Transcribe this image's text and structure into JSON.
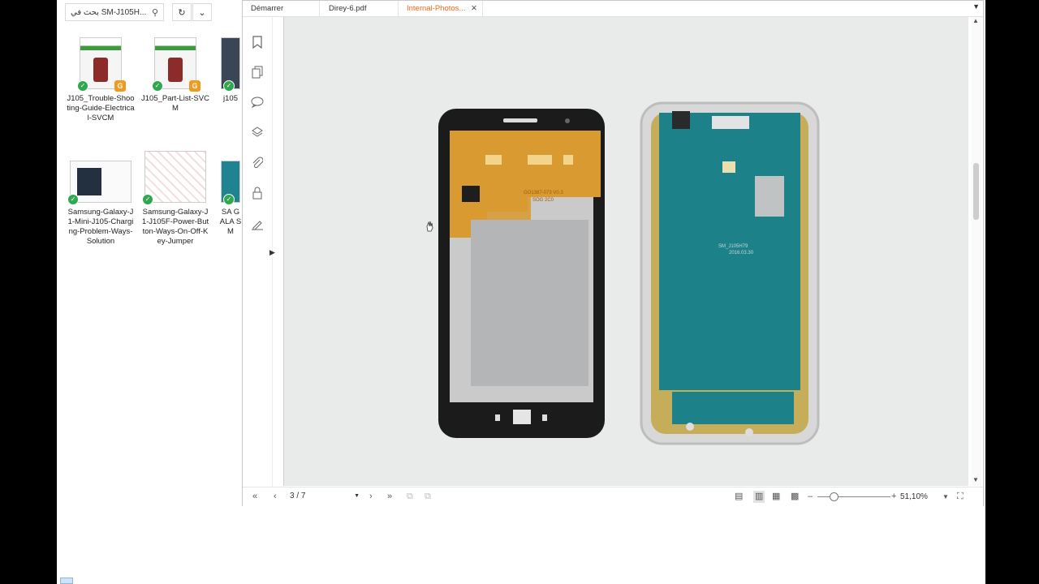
{
  "explorer": {
    "search_text": "بحث في SM-J105H...",
    "files": [
      {
        "name": "J105_Trouble-Shooting-Guide-Electrical-SVCM"
      },
      {
        "name": "J105_Part-List-SVCM"
      },
      {
        "name": "j105"
      },
      {
        "name": "Samsung-Galaxy-J1-Mini-J105-Charging-Problem-Ways-Solution"
      },
      {
        "name": "Samsung-Galaxy-J1-J105F-Power-Button-Ways-On-Off-Key-Jumper"
      },
      {
        "name": "SA GALA SM"
      }
    ]
  },
  "pdf": {
    "tabs": [
      {
        "label": "Démarrer"
      },
      {
        "label": "Direy-6.pdf"
      },
      {
        "label": "Internal-Photos..."
      }
    ],
    "page_indicator": "3 / 7",
    "zoom_label": "51,10%",
    "board_print": {
      "line1": "GO1387-073 V0.3",
      "line2": "SOG 2C0",
      "pcb_label1": "SM_J105H79",
      "pcb_label2": "2016.03.30"
    }
  },
  "icons": {
    "search": "search-icon",
    "refresh": "refresh-icon",
    "bookmark": "bookmark-icon",
    "pages": "pages-icon",
    "comments": "comment-icon",
    "layers": "layers-icon",
    "attachments": "paperclip-icon",
    "security": "lock-icon",
    "signature": "signature-icon"
  }
}
